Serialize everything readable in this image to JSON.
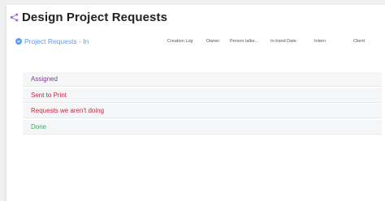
{
  "board": {
    "title": "Design Project Requests",
    "accent_color": "#a25ddc"
  },
  "group_header": {
    "name": "Project Requests - In",
    "color": "#579bfc",
    "columns": [
      "Creation Log",
      "Owner",
      "Person talke...",
      "In-hand Date",
      "Intern",
      "Client"
    ]
  },
  "groups": [
    {
      "label": "Assigned",
      "color": "#7e3b8a"
    },
    {
      "label": "Sent to Print",
      "color": "#c4253d"
    },
    {
      "label": "Requests we aren't doing",
      "color": "#c4253d"
    },
    {
      "label": "Done",
      "color": "#33b35a"
    }
  ]
}
